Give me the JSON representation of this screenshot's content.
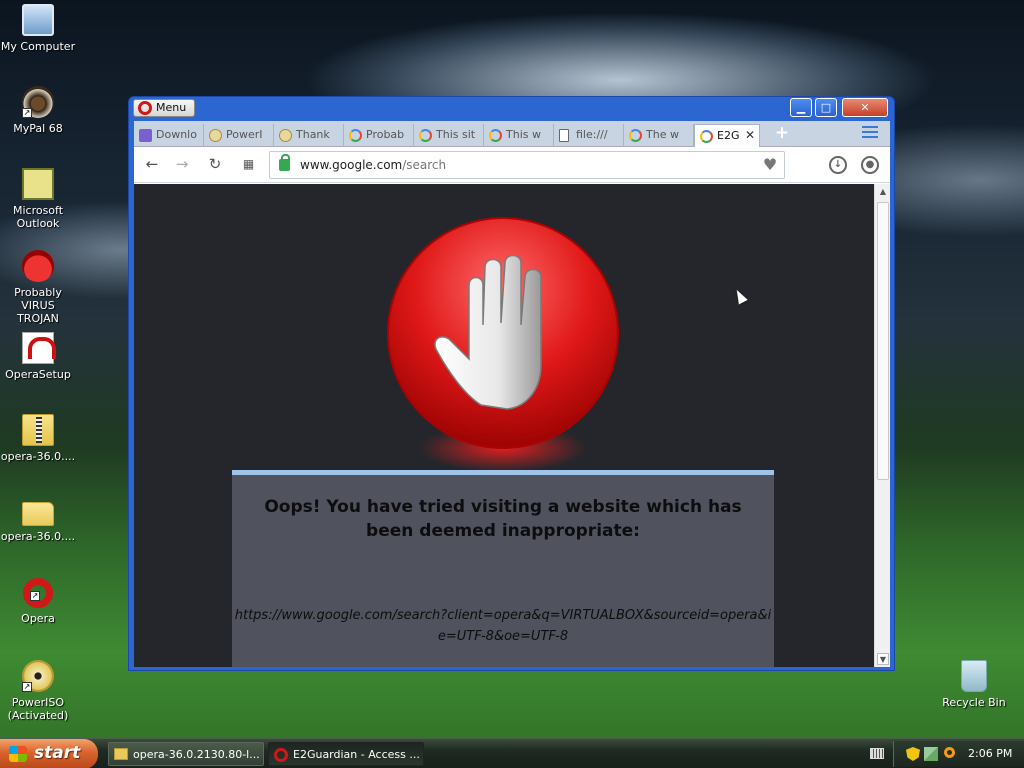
{
  "desktop": {
    "icons": [
      {
        "label_1": "My Computer",
        "label_2": "",
        "icon": "computer-icon"
      },
      {
        "label_1": "MyPal 68",
        "label_2": "",
        "icon": "mypal-icon"
      },
      {
        "label_1": "Microsoft",
        "label_2": "Outlook",
        "icon": "outlook-icon"
      },
      {
        "label_1": "Probably",
        "label_2": "VIRUS TROJAN",
        "icon": "bug-icon"
      },
      {
        "label_1": "OperaSetup",
        "label_2": "",
        "icon": "opera-setup-icon"
      },
      {
        "label_1": "opera-36.0....",
        "label_2": "",
        "icon": "zip-folder-icon"
      },
      {
        "label_1": "opera-36.0....",
        "label_2": "",
        "icon": "folder-icon"
      },
      {
        "label_1": "Opera",
        "label_2": "",
        "icon": "opera-icon"
      },
      {
        "label_1": "PowerISO",
        "label_2": "(Activated)",
        "icon": "poweriso-icon"
      },
      {
        "label_1": "Recycle Bin",
        "label_2": "",
        "icon": "recycle-bin-icon"
      }
    ]
  },
  "browser": {
    "menu_label": "Menu",
    "window_buttons": {
      "minimize": "▁",
      "maximize": "□",
      "close": "✕"
    },
    "tabs": [
      {
        "title": "Downlo",
        "icon": "mk-favicon"
      },
      {
        "title": "PowerI",
        "icon": "poweriso-favicon"
      },
      {
        "title": "Thank",
        "icon": "poweriso-favicon"
      },
      {
        "title": "Probab",
        "icon": "google-favicon"
      },
      {
        "title": "This sit",
        "icon": "google-favicon"
      },
      {
        "title": "This w",
        "icon": "google-favicon"
      },
      {
        "title": "file:///",
        "icon": "file-favicon"
      },
      {
        "title": "The w",
        "icon": "google-favicon"
      },
      {
        "title": "E2G",
        "icon": "google-favicon",
        "active": true
      }
    ],
    "tab_close": "✕",
    "new_tab": "+",
    "address": {
      "host": "www.google.com",
      "path": "/search"
    }
  },
  "page": {
    "message": "Oops! You have tried visiting a website which has been deemed inappropriate:",
    "blocked_url": "https://www.google.com/search?client=opera&q=VIRTUALBOX&sourceid=opera&ie=UTF-8&oe=UTF-8"
  },
  "taskbar": {
    "start_label": "start",
    "tasks": [
      {
        "label": "opera-36.0.2130.80-l...",
        "icon": "folder-icon"
      },
      {
        "label": "E2Guardian - Access ...",
        "icon": "opera-icon",
        "active": true
      }
    ],
    "clock": "2:06 PM"
  }
}
